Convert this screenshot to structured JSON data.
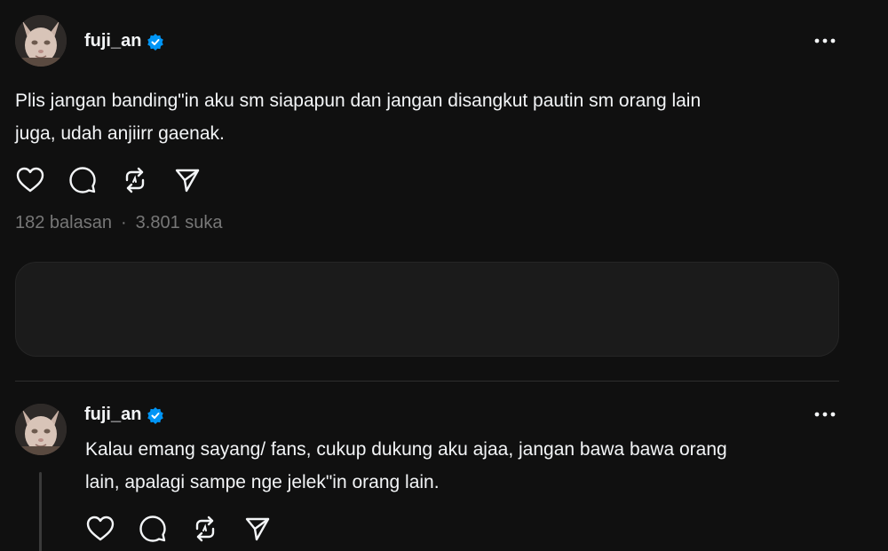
{
  "post": {
    "username": "fuji_an",
    "text_line1": "Plis jangan banding\"in aku sm siapapun dan jangan disangkut pautin sm orang lain",
    "text_line2": "juga, udah anjiirr gaenak.",
    "replies": "182 balasan",
    "separator": "·",
    "likes": "3.801 suka"
  },
  "reply": {
    "username": "fuji_an",
    "text_line1": "Kalau emang sayang/ fans, cukup dukung aku ajaa, jangan bawa bawa orang",
    "text_line2": "lain, apalagi sampe nge jelek\"in orang lain."
  },
  "icons": {
    "like": "heart-icon",
    "comment": "comment-icon",
    "repost": "repost-icon",
    "share": "send-icon",
    "more": "more-icon",
    "verified": "verified-badge-icon"
  },
  "colors": {
    "background": "#101010",
    "text": "#f3f5f7",
    "muted": "#777777",
    "verified": "#0095f6"
  }
}
